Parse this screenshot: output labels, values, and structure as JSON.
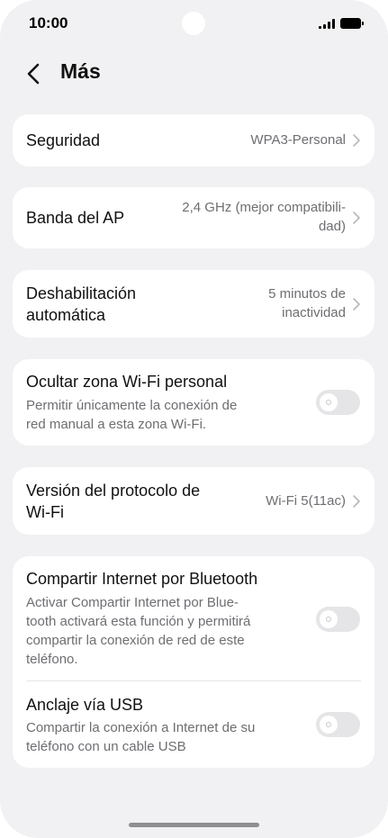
{
  "status_bar": {
    "time": "10:00"
  },
  "header": {
    "title": "Más"
  },
  "settings": {
    "security": {
      "label": "Seguridad",
      "value": "WPA3-Personal"
    },
    "ap_band": {
      "label": "Banda del AP",
      "value_line1": "2,4 GHz (mejor compatibili-",
      "value_line2": "dad)"
    },
    "auto_disable": {
      "label_line1": "Deshabilitación",
      "label_line2": "automática",
      "value_line1": "5 minutos de",
      "value_line2": "inactividad"
    },
    "hide_hotspot": {
      "label": "Ocultar zona Wi-Fi personal",
      "desc_line1": "Permitir únicamente la conexión de",
      "desc_line2": "red manual a esta zona Wi-Fi.",
      "enabled": false
    },
    "wifi_protocol": {
      "label_line1": "Versión del protocolo de",
      "label_line2": "Wi-Fi",
      "value": "Wi-Fi 5(11ac)"
    },
    "bluetooth_tethering": {
      "label": "Compartir Internet por Bluetooth",
      "desc_line1": "Activar Compartir Internet por Blue-",
      "desc_line2": "tooth activará esta función y permitirá",
      "desc_line3": "compartir la conexión de red de este",
      "desc_line4": "teléfono.",
      "enabled": false
    },
    "usb_tethering": {
      "label": "Anclaje vía USB",
      "desc_line1": "Compartir la conexión a Internet de su",
      "desc_line2": "teléfono con un cable USB",
      "enabled": false
    }
  },
  "colors": {
    "background": "#f1f1f3",
    "card": "#ffffff",
    "secondary_text": "#6e6e73",
    "toggle_off": "#e5e5e7"
  }
}
